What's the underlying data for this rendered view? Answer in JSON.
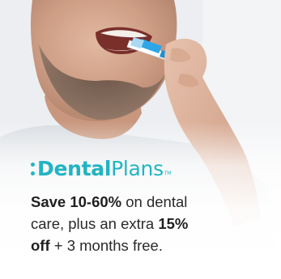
{
  "ad": {
    "logo": {
      "part1": "Dental",
      "part2": "Plans",
      "tm": "TM",
      "color1": "#22b3c3",
      "color2": "#1fb5c6"
    },
    "copy": {
      "l1_bold": "Save 10-60%",
      "l1_rest": " on dental",
      "l2_a": "care, plus an extra ",
      "l2_bold": "15%",
      "l3_bold": "off",
      "l3_rest": " + 3 months free."
    },
    "colors": {
      "accent": "#1fb5c6",
      "text": "#2a2a2a"
    },
    "image": {
      "subject": "man brushing teeth with a blue toothbrush"
    }
  }
}
